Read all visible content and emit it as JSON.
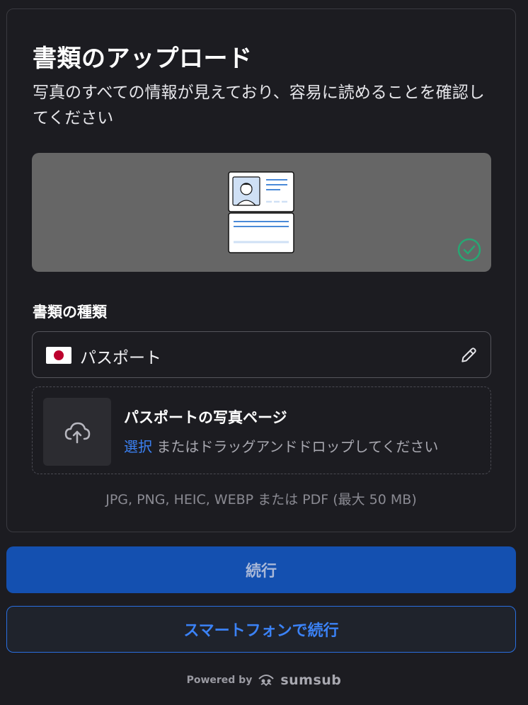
{
  "header": {
    "title": "書類のアップロード",
    "subtitle": "写真のすべての情報が見えており、容易に読めることを確認してください"
  },
  "preview": {
    "illustration": "passport-document-icon",
    "status_icon": "check-circle-icon",
    "status_color": "#27a773"
  },
  "document_type": {
    "label": "書類の種類",
    "value": "パスポート",
    "flag": "japan-flag",
    "edit_icon": "pencil-icon"
  },
  "upload": {
    "title": "パスポートの写真ページ",
    "select_label": "選択",
    "hint": "またはドラッグアンドドロップしてください",
    "icon": "cloud-upload-icon",
    "formats": "JPG, PNG, HEIC, WEBP または PDF (最大 50 MB)"
  },
  "actions": {
    "continue_label": "続行",
    "smartphone_label": "スマートフォンで続行"
  },
  "footer": {
    "powered_by": "Powered by",
    "brand": "sumsub"
  },
  "colors": {
    "background": "#1c1c21",
    "primary": "#1450b0",
    "accent": "#3b82f6"
  }
}
